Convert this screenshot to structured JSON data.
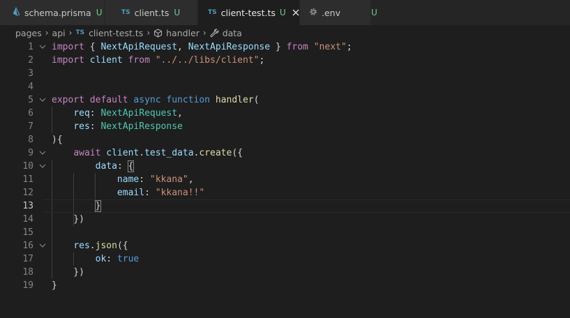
{
  "tabs": [
    {
      "icon_text": "",
      "label": "schema.prisma",
      "status": "U",
      "active": false
    },
    {
      "icon_text": "TS",
      "label": "client.ts",
      "status": "U",
      "active": false
    },
    {
      "icon_text": "TS",
      "label": "client-test.ts",
      "status": "U",
      "active": true
    },
    {
      "icon_text": "",
      "label": ".env",
      "status": "U",
      "active": false
    }
  ],
  "breadcrumb": {
    "items": [
      "pages",
      "api",
      "client-test.ts",
      "handler",
      "data"
    ],
    "ts_icon": "TS"
  },
  "editor": {
    "current_line": 13,
    "lines": [
      {
        "n": "1",
        "fold": true,
        "text": "import { NextApiRequest, NextApiResponse } from \"next\";"
      },
      {
        "n": "2",
        "fold": false,
        "text": "import client from \"../../libs/client\";"
      },
      {
        "n": "3",
        "fold": false,
        "text": ""
      },
      {
        "n": "4",
        "fold": false,
        "text": ""
      },
      {
        "n": "5",
        "fold": true,
        "text": "export default async function handler("
      },
      {
        "n": "6",
        "fold": false,
        "text": "    req: NextApiRequest,"
      },
      {
        "n": "7",
        "fold": false,
        "text": "    res: NextApiResponse"
      },
      {
        "n": "8",
        "fold": false,
        "text": "){"
      },
      {
        "n": "9",
        "fold": true,
        "text": "    await client.test_data.create({"
      },
      {
        "n": "10",
        "fold": true,
        "text": "        data: {"
      },
      {
        "n": "11",
        "fold": false,
        "text": "            name: \"kkana\","
      },
      {
        "n": "12",
        "fold": false,
        "text": "            email: \"kkana!!\""
      },
      {
        "n": "13",
        "fold": false,
        "text": "        }"
      },
      {
        "n": "14",
        "fold": false,
        "text": "    })"
      },
      {
        "n": "15",
        "fold": false,
        "text": ""
      },
      {
        "n": "16",
        "fold": true,
        "text": "    res.json({"
      },
      {
        "n": "17",
        "fold": false,
        "text": "        ok: true"
      },
      {
        "n": "18",
        "fold": false,
        "text": "    })"
      },
      {
        "n": "19",
        "fold": false,
        "text": "}"
      }
    ]
  },
  "colors": {
    "keyword_control": "#c586c0",
    "keyword": "#569cd6",
    "type": "#4ec9b0",
    "variable": "#9cdcfe",
    "string": "#ce9178",
    "function": "#dcdcaa",
    "git_untracked": "#73c991",
    "ts_icon": "#519aba",
    "prisma_icon": "#519aba",
    "env_icon": "#8c8c8c"
  },
  "icons": {
    "prisma_tab": "prisma-icon",
    "ts_tab": "typescript-icon",
    "env_tab": "gear-icon",
    "close": "close-icon",
    "breadcrumb_handler": "method-icon",
    "breadcrumb_data": "wrench-icon",
    "fold": "chevron-down-icon"
  }
}
